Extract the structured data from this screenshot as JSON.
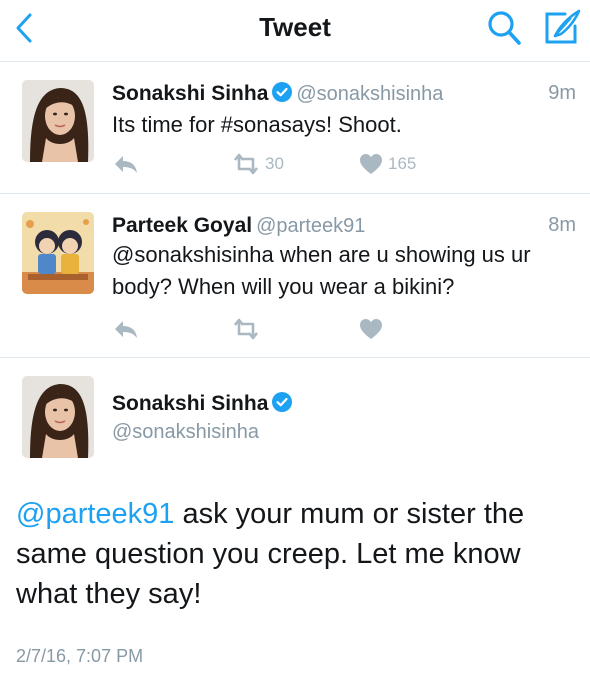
{
  "nav": {
    "title": "Tweet"
  },
  "tweets": [
    {
      "name": "Sonakshi Sinha",
      "handle": "@sonakshisinha",
      "time": "9m",
      "text": "Its time for #sonasays! Shoot.",
      "retweets": "30",
      "likes": "165",
      "verified": true
    },
    {
      "name": "Parteek Goyal",
      "handle": "@parteek91",
      "time": "8m",
      "text": "@sonakshisinha when are u showing us ur body? When will you wear a bikini?",
      "retweets": "",
      "likes": "",
      "verified": false
    }
  ],
  "main": {
    "name": "Sonakshi Sinha",
    "handle": "@sonakshisinha",
    "mention": "@parteek91",
    "text": " ask your mum or sister the same question you creep. Let me know what they say!",
    "date": "2/7/16, 7:07 PM"
  },
  "colors": {
    "accent": "#1da1f2",
    "muted": "#8899a6",
    "icon": "#aab8c2",
    "divider": "#e1e8ed"
  },
  "icons": [
    "back-chevron-icon",
    "search-icon",
    "compose-icon",
    "verified-badge-icon",
    "reply-icon",
    "retweet-icon",
    "heart-icon"
  ]
}
